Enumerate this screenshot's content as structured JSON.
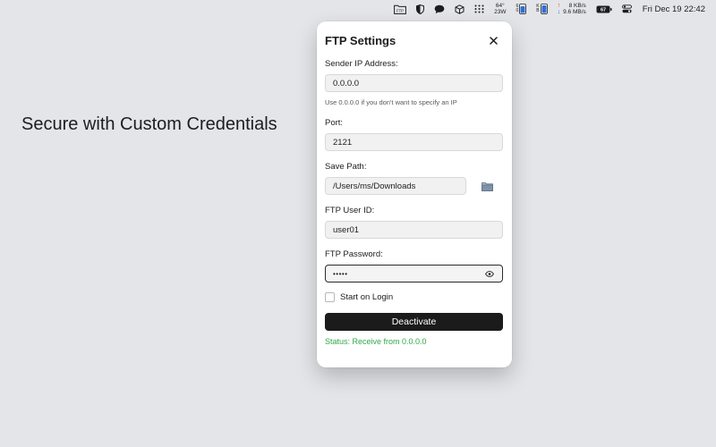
{
  "menubar": {
    "ftp_badge": "FTP",
    "weather": {
      "temp": "64°",
      "wind": "23W"
    },
    "net": {
      "up_arrow": "↑",
      "down_arrow": "↓",
      "up": "8 KB/s",
      "down": "9.6 MB/s"
    },
    "battery_label": "67",
    "mini_labels": [
      "6",
      "0",
      "0",
      "K",
      "B"
    ],
    "clock": "Fri Dec 19  22:42"
  },
  "headline": "Secure with Custom Credentials",
  "dialog": {
    "title": "FTP Settings",
    "sender_ip": {
      "label": "Sender IP Address:",
      "value": "0.0.0.0",
      "hint": "Use 0.0.0.0 if you don't want to specify an IP"
    },
    "port": {
      "label": "Port:",
      "value": "2121"
    },
    "save_path": {
      "label": "Save Path:",
      "value": "/Users/ms/Downloads"
    },
    "user_id": {
      "label": "FTP User ID:",
      "value": "user01"
    },
    "password": {
      "label": "FTP Password:",
      "masked": "•••••"
    },
    "start_on_login": {
      "label": "Start on Login",
      "checked": false
    },
    "action_button": "Deactivate",
    "status": "Status: Receive from 0.0.0.0"
  },
  "colors": {
    "desktop": "#e4e5e8",
    "button": "#1b1b1b",
    "status": "#2fa84a",
    "upload": "#d63a2f",
    "download": "#2f6fd6"
  }
}
